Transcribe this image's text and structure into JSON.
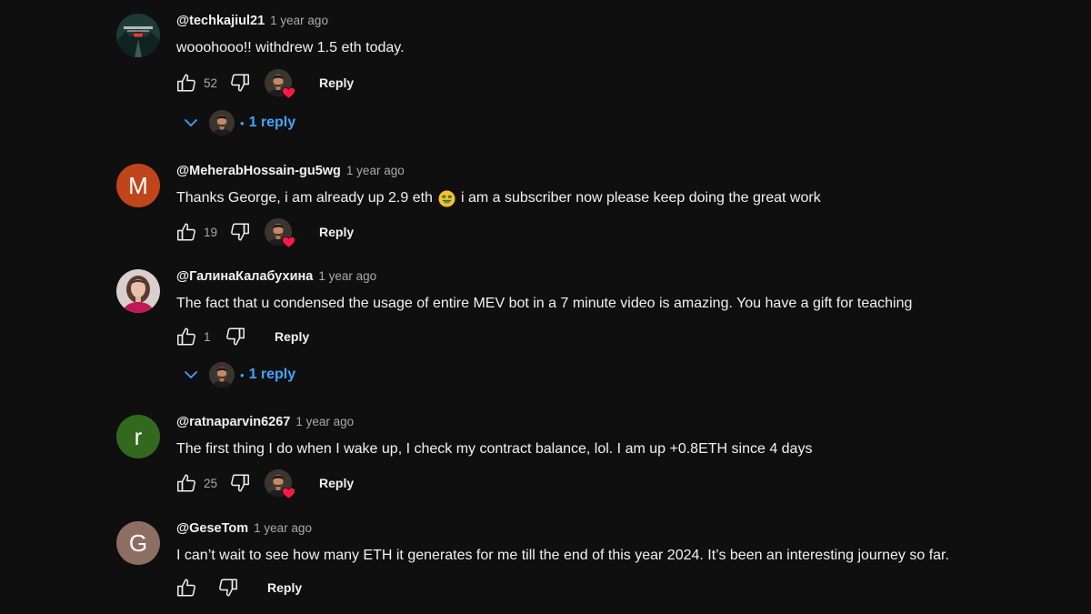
{
  "comments": [
    {
      "author": "@techkajiul21",
      "time": "1 year ago",
      "text": "wooohooo!! withdrew 1.5 eth today.",
      "likes": "52",
      "avatar": {
        "type": "image",
        "caption": "KAZIUL & SABHA"
      },
      "hearted": true,
      "reply_label": "Reply",
      "replies_label": "1 reply"
    },
    {
      "author": "@MeherabHossain-gu5wg",
      "time": "1 year ago",
      "text_before": "Thanks George, i am already up 2.9 eth",
      "text_after": "i am a subscriber now please keep doing the great work",
      "likes": "19",
      "avatar": {
        "type": "letter",
        "letter": "M",
        "color": "#c0451b"
      },
      "hearted": true,
      "reply_label": "Reply"
    },
    {
      "author": "@ГалинаКалабухина",
      "time": "1 year ago",
      "text": "The fact that u condensed the usage of entire MEV bot in a 7 minute video is amazing. You have a gift for teaching",
      "likes": "1",
      "avatar": {
        "type": "image"
      },
      "hearted": false,
      "reply_label": "Reply",
      "replies_label": "1 reply"
    },
    {
      "author": "@ratnaparvin6267",
      "time": "1 year ago",
      "text": "The first thing I do when I wake up, I check my contract balance, lol. I am up +0.8ETH since 4 days",
      "likes": "25",
      "avatar": {
        "type": "letter",
        "letter": "r",
        "color": "#33691e"
      },
      "hearted": true,
      "reply_label": "Reply"
    },
    {
      "author": "@GeseTom",
      "time": "1 year ago",
      "text": "I can’t wait to see how many ETH it generates for me till the end of this year 2024. It’s been an interesting journey so far.",
      "likes": "",
      "avatar": {
        "type": "letter",
        "letter": "G",
        "color": "#8d6e63"
      },
      "hearted": false,
      "reply_label": "Reply"
    }
  ],
  "colors": {
    "background": "#0f0f0f",
    "text": "#f1f1f1",
    "muted": "#aaaaaa",
    "link": "#3ea6ff",
    "heart": "#ff1744"
  },
  "icons": [
    "thumbs-up-icon",
    "thumbs-down-icon",
    "creator-heart-icon",
    "chevron-down-icon",
    "money-mouth-emoji"
  ]
}
